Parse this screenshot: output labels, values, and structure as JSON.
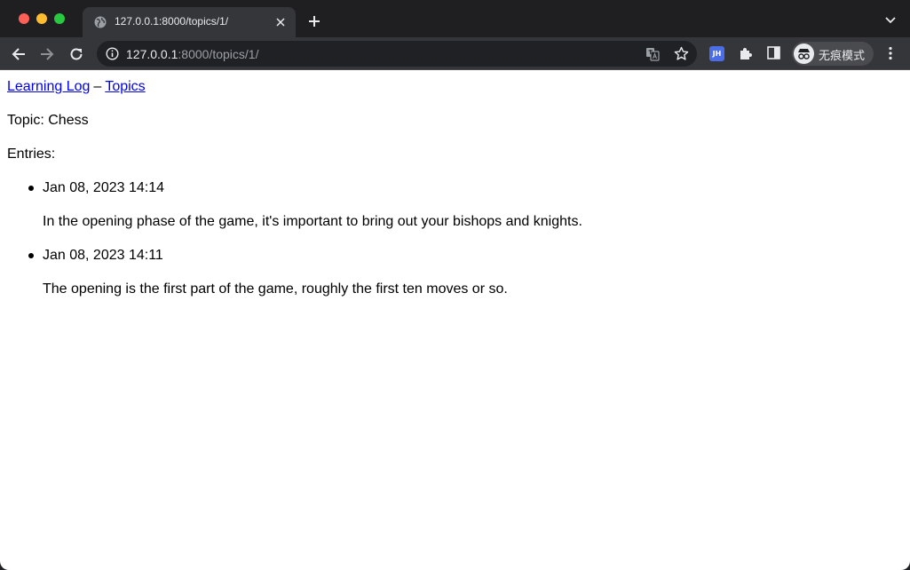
{
  "browser": {
    "tab_title": "127.0.0.1:8000/topics/1/",
    "url_host": "127.0.0.1",
    "url_rest": ":8000/topics/1/",
    "extension_jh": "JH",
    "incognito_label": "无痕模式"
  },
  "page": {
    "nav": {
      "home_link": "Learning Log",
      "separator": "–",
      "topics_link": "Topics"
    },
    "topic_line": "Topic: Chess",
    "entries_heading": "Entries:",
    "entries": [
      {
        "date": "Jan 08, 2023 14:14",
        "text": "In the opening phase of the game, it's important to bring out your bishops and knights."
      },
      {
        "date": "Jan 08, 2023 14:11",
        "text": "The opening is the first part of the game, roughly the first ten moves or so."
      }
    ]
  }
}
